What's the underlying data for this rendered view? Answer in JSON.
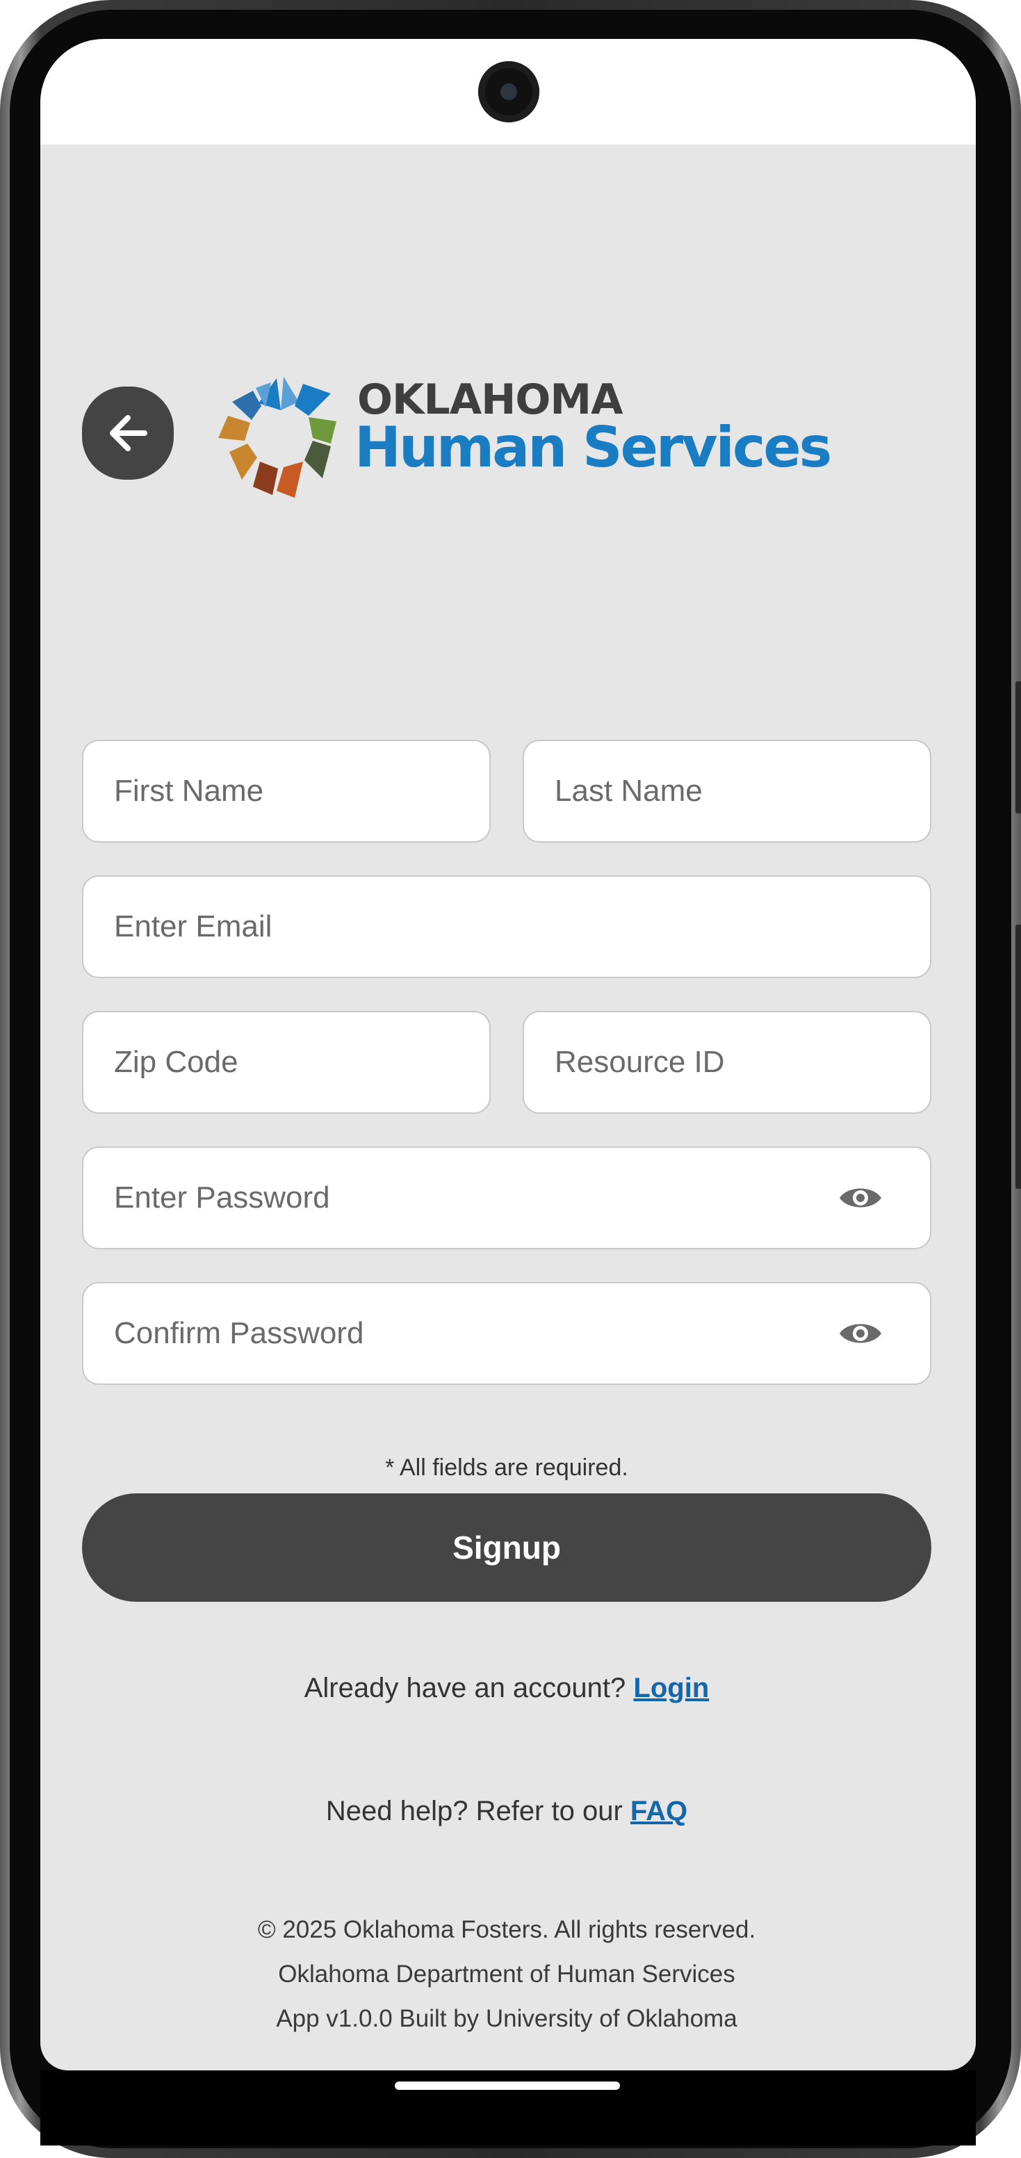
{
  "header": {
    "back_icon": "arrow-left-icon",
    "logo": {
      "line1": "OKLAHOMA",
      "line2": "Human Services",
      "colors": {
        "line1": "#3f3f3f",
        "line2": "#1a7cc2",
        "mark": [
          "#1a7cc2",
          "#5aa0d6",
          "#6e9a3c",
          "#4a5a3a",
          "#c85a24",
          "#8a3c1c",
          "#c8862e",
          "#2e6fae"
        ]
      }
    }
  },
  "form": {
    "first_name_placeholder": "First Name",
    "last_name_placeholder": "Last Name",
    "email_placeholder": "Enter Email",
    "zip_placeholder": "Zip Code",
    "resource_id_placeholder": "Resource ID",
    "password_placeholder": "Enter Password",
    "confirm_password_placeholder": "Confirm Password",
    "visibility_icon": "eye-icon",
    "required_note": "* All fields are required.",
    "signup_label": "Signup"
  },
  "links": {
    "login_prompt": "Already have an account?",
    "login_label": "Login",
    "help_prompt": "Need help? Refer to our",
    "faq_label": "FAQ",
    "link_color": "#1467a8"
  },
  "footer": {
    "copyright": "© 2025 Oklahoma Fosters. All rights reserved.",
    "department": "Oklahoma Department of Human Services",
    "version": "App v1.0.0 Built by University of Oklahoma"
  },
  "theme": {
    "background": "#e6e6e6",
    "button": "#454545",
    "field_border": "#c9c9c9"
  }
}
